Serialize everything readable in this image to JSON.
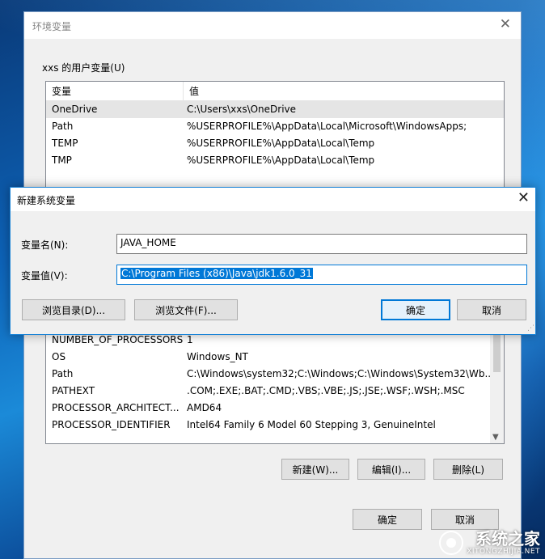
{
  "env_window": {
    "title": "环境变量",
    "close_glyph": "✕",
    "user_group_label": "xxs 的用户变量(U)",
    "columns": [
      "变量",
      "值"
    ],
    "user_vars": [
      {
        "name": "OneDrive",
        "value": "C:\\Users\\xxs\\OneDrive"
      },
      {
        "name": "Path",
        "value": "%USERPROFILE%\\AppData\\Local\\Microsoft\\WindowsApps;"
      },
      {
        "name": "TEMP",
        "value": "%USERPROFILE%\\AppData\\Local\\Temp"
      },
      {
        "name": "TMP",
        "value": "%USERPROFILE%\\AppData\\Local\\Temp"
      }
    ],
    "system_vars": [
      {
        "name": "NUMBER_OF_PROCESSORS",
        "value": "1"
      },
      {
        "name": "OS",
        "value": "Windows_NT"
      },
      {
        "name": "Path",
        "value": "C:\\Windows\\system32;C:\\Windows;C:\\Windows\\System32\\Wb..."
      },
      {
        "name": "PATHEXT",
        "value": ".COM;.EXE;.BAT;.CMD;.VBS;.VBE;.JS;.JSE;.WSF;.WSH;.MSC"
      },
      {
        "name": "PROCESSOR_ARCHITECT...",
        "value": "AMD64"
      },
      {
        "name": "PROCESSOR_IDENTIFIER",
        "value": "Intel64 Family 6 Model 60 Stepping 3, GenuineIntel"
      }
    ],
    "buttons": {
      "new": "新建(W)...",
      "edit": "编辑(I)...",
      "delete": "删除(L)",
      "ok": "确定",
      "cancel": "取消"
    }
  },
  "dialog": {
    "title": "新建系统变量",
    "close_glyph": "✕",
    "name_label": "变量名(N):",
    "value_label": "变量值(V):",
    "name_value": "JAVA_HOME",
    "value_value": "C:\\Program Files (x86)\\Java\\jdk1.6.0_31",
    "buttons": {
      "browse_dir": "浏览目录(D)...",
      "browse_file": "浏览文件(F)...",
      "ok": "确定",
      "cancel": "取消"
    }
  },
  "watermark": {
    "main": "系统之家",
    "sub": "XITONGZHIJIA.NET"
  }
}
